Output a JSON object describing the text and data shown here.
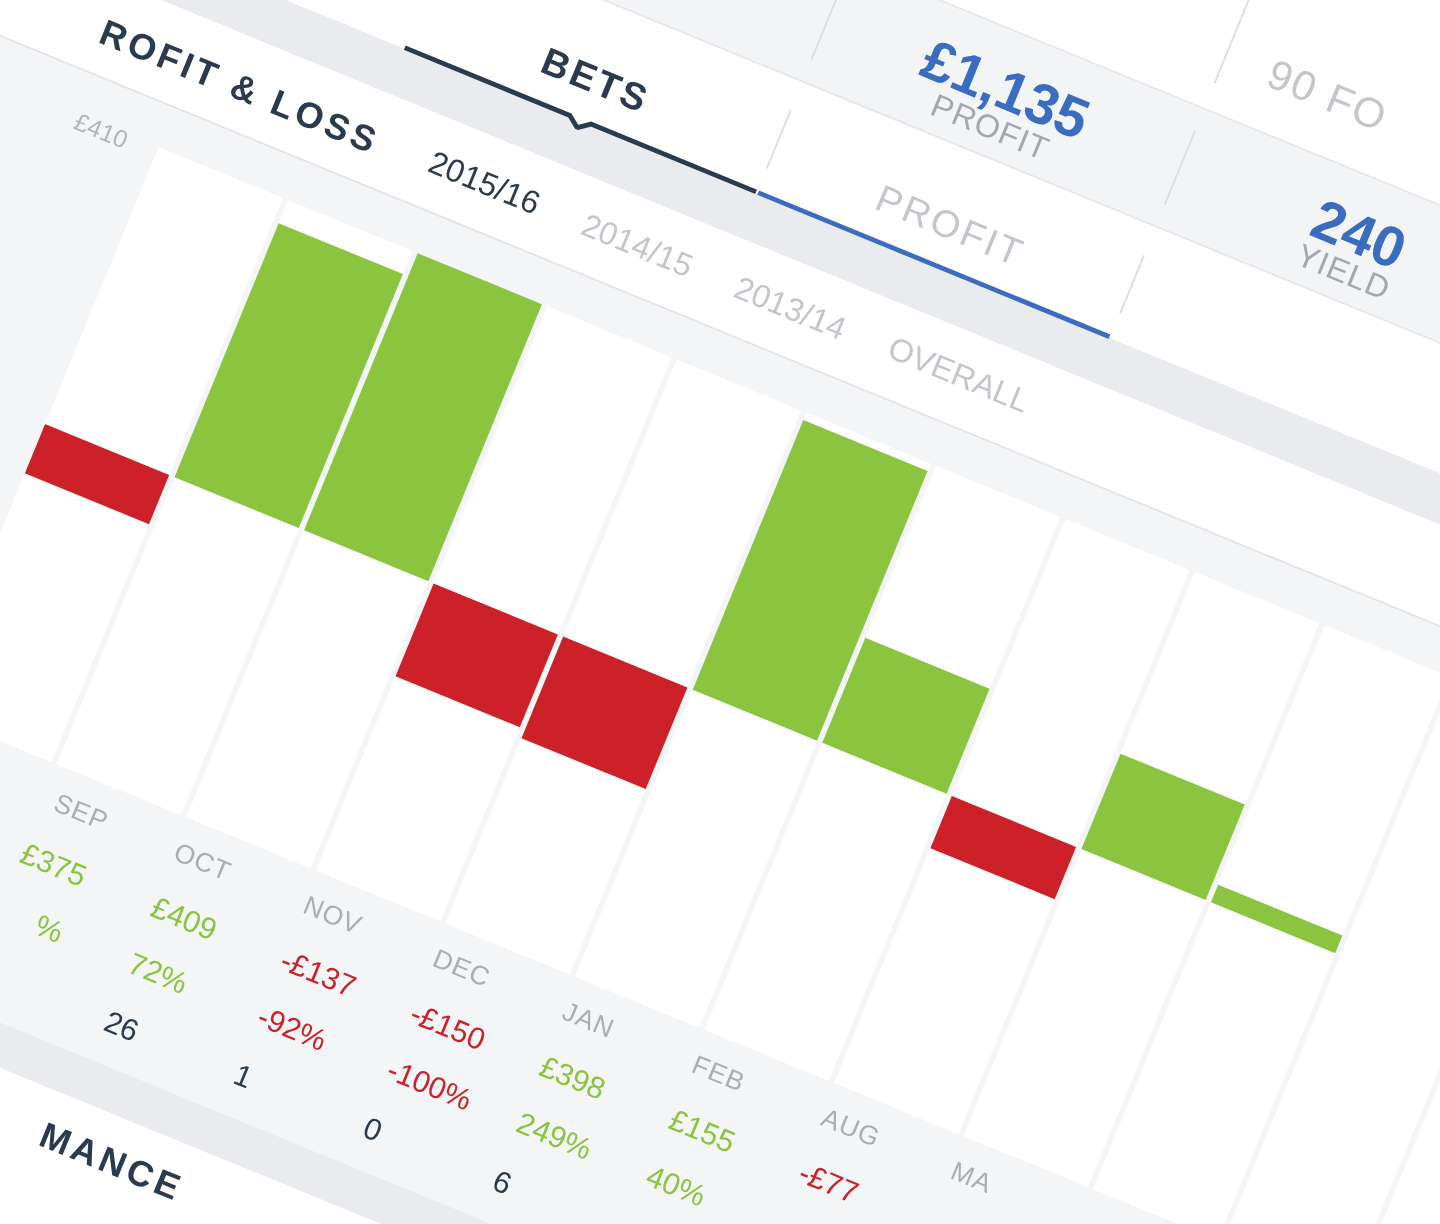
{
  "info_row": [
    {
      "text": "90 FO"
    }
  ],
  "summary": [
    {
      "value": "£1,135",
      "label": "PROFIT"
    },
    {
      "value": "240",
      "label": "YIELD"
    }
  ],
  "tabs": [
    {
      "label": "BETS",
      "selected": true,
      "color": "#2b3b4e"
    },
    {
      "label": "PROFIT",
      "selected": false,
      "color": "#3a6cc0"
    }
  ],
  "profit_loss": {
    "title": "ROFIT & LOSS",
    "periods": [
      {
        "label": "2015/16",
        "selected": true
      },
      {
        "label": "2014/15",
        "selected": false
      },
      {
        "label": "2013/14",
        "selected": false
      },
      {
        "label": "OVERALL",
        "selected": false
      }
    ],
    "axis_label": "£410",
    "table": {
      "columns": [
        {
          "kind": "cut",
          "month": "SEP",
          "negative": false,
          "profit": "£375",
          "yield": "%"
        },
        {
          "kind": "full",
          "month": "OCT",
          "negative": false,
          "profit": "£409",
          "yield": "72%",
          "bets": "26"
        },
        {
          "kind": "full",
          "month": "NOV",
          "negative": true,
          "profit": "-£137",
          "yield": "-92%",
          "bets": "1"
        },
        {
          "kind": "full",
          "month": "DEC",
          "negative": true,
          "profit": "-£150",
          "yield": "-100%",
          "bets": "0"
        },
        {
          "kind": "full",
          "month": "JAN",
          "negative": false,
          "profit": "£398",
          "yield": "249%",
          "bets": "6"
        },
        {
          "kind": "full",
          "month": "FEB",
          "negative": false,
          "profit": "£155",
          "yield": "40%"
        },
        {
          "kind": "full",
          "month": "AUG",
          "negative": true,
          "profit": "-£77"
        },
        {
          "kind": "full",
          "month": "MA"
        }
      ]
    }
  },
  "performance": {
    "title": "MANCE"
  }
}
